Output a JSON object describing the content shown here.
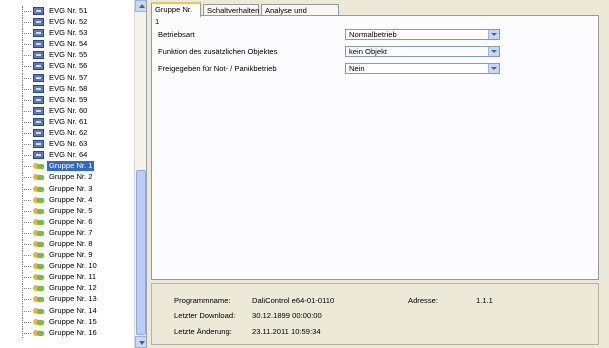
{
  "tree": {
    "items": [
      {
        "label": "EVG Nr. 51",
        "kind": "evg"
      },
      {
        "label": "EVG Nr. 52",
        "kind": "evg"
      },
      {
        "label": "EVG Nr. 53",
        "kind": "evg"
      },
      {
        "label": "EVG Nr. 54",
        "kind": "evg"
      },
      {
        "label": "EVG Nr. 55",
        "kind": "evg"
      },
      {
        "label": "EVG Nr. 56",
        "kind": "evg"
      },
      {
        "label": "EVG Nr. 57",
        "kind": "evg"
      },
      {
        "label": "EVG Nr. 58",
        "kind": "evg"
      },
      {
        "label": "EVG Nr. 59",
        "kind": "evg"
      },
      {
        "label": "EVG Nr. 60",
        "kind": "evg"
      },
      {
        "label": "EVG Nr. 61",
        "kind": "evg"
      },
      {
        "label": "EVG Nr. 62",
        "kind": "evg"
      },
      {
        "label": "EVG Nr. 63",
        "kind": "evg"
      },
      {
        "label": "EVG Nr. 64",
        "kind": "evg"
      },
      {
        "label": "Gruppe Nr. 1",
        "kind": "group",
        "selected": true
      },
      {
        "label": "Gruppe Nr. 2",
        "kind": "group"
      },
      {
        "label": "Gruppe Nr. 3",
        "kind": "group"
      },
      {
        "label": "Gruppe Nr. 4",
        "kind": "group"
      },
      {
        "label": "Gruppe Nr. 5",
        "kind": "group"
      },
      {
        "label": "Gruppe Nr. 6",
        "kind": "group"
      },
      {
        "label": "Gruppe Nr. 7",
        "kind": "group"
      },
      {
        "label": "Gruppe Nr. 8",
        "kind": "group"
      },
      {
        "label": "Gruppe Nr. 9",
        "kind": "group"
      },
      {
        "label": "Gruppe Nr. 10",
        "kind": "group"
      },
      {
        "label": "Gruppe Nr. 11",
        "kind": "group"
      },
      {
        "label": "Gruppe Nr. 12",
        "kind": "group"
      },
      {
        "label": "Gruppe Nr. 13",
        "kind": "group"
      },
      {
        "label": "Gruppe Nr. 14",
        "kind": "group"
      },
      {
        "label": "Gruppe Nr. 15",
        "kind": "group"
      },
      {
        "label": "Gruppe Nr. 16",
        "kind": "group"
      }
    ]
  },
  "tabs": [
    {
      "label": "Gruppe Nr. 1",
      "active": true
    },
    {
      "label": "Schaltverhalten"
    },
    {
      "label": "Analyse und Wartung"
    }
  ],
  "properties": [
    {
      "label": "Betriebsart",
      "value": "Normalbetrieb"
    },
    {
      "label": "Funktion des zusätzlichen Objektes",
      "value": "kein Objekt"
    },
    {
      "label": "Freigegeben für Not- / Panikbetrieb",
      "value": "Nein"
    }
  ],
  "status": {
    "program_label": "Programmname:",
    "program_value": "DaliControl e64-01-0110",
    "address_label": "Adresse:",
    "address_value": "1.1.1",
    "download_label": "Letzter Download:",
    "download_value": "30.12.1899 00:00:00",
    "change_label": "Letzte Änderung:",
    "change_value": "23.11.2011 10:59:34"
  },
  "colors": {
    "selection": "#316ac5",
    "tab_highlight": "#f3c44d",
    "panel_bg": "#ece9d8"
  }
}
